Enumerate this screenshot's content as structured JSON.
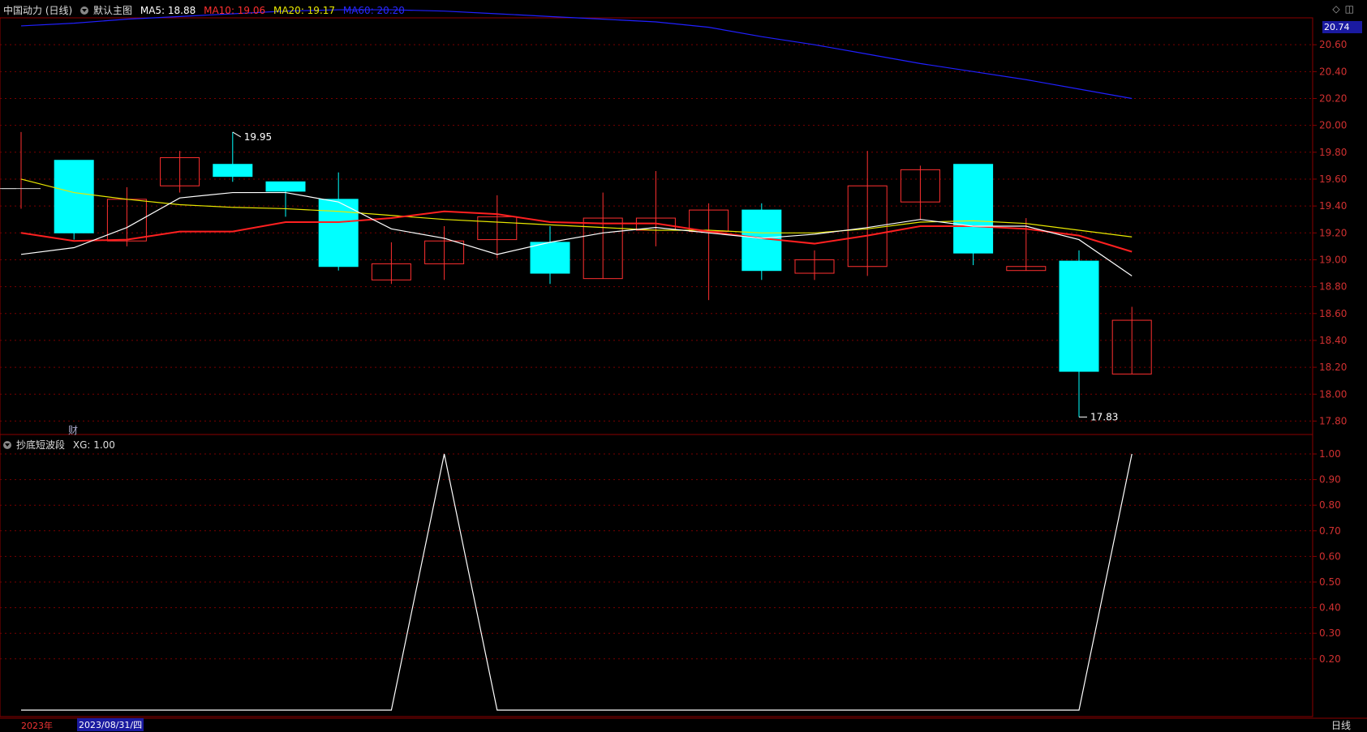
{
  "header": {
    "stock": "中国动力 (日线)",
    "main_chart": "默认主图",
    "ma5": "MA5: 18.88",
    "ma10": "MA10: 19.06",
    "ma20": "MA20: 19.17",
    "ma60": "MA60: 20.20"
  },
  "indicator": {
    "name": "抄底短波段",
    "xg": "XG: 1.00"
  },
  "footer": {
    "year": "2023年",
    "date": "2023/08/31/四",
    "period": "日线"
  },
  "markers": {
    "cai": "财",
    "price_tag": "20.74",
    "high_label": "19.95",
    "low_label": "17.83"
  },
  "colors": {
    "up": "#ff3030",
    "down": "#00ffff",
    "ma5": "#ffffff",
    "ma10": "#ff2020",
    "ma20": "#e8e800",
    "ma60": "#2020ff",
    "grid": "#8b0000"
  },
  "chart_data": [
    {
      "type": "candlestick",
      "y_ticks": [
        "20.60",
        "20.40",
        "20.20",
        "20.00",
        "19.80",
        "19.60",
        "19.40",
        "19.20",
        "19.00",
        "18.80",
        "18.60",
        "18.40",
        "18.20",
        "18.00",
        "17.80"
      ],
      "candles": [
        {
          "open": 19.53,
          "close": 19.53,
          "high": 19.95,
          "low": 19.38
        },
        {
          "open": 19.74,
          "close": 19.2,
          "high": 19.74,
          "low": 19.15
        },
        {
          "open": 19.14,
          "close": 19.45,
          "high": 19.54,
          "low": 19.1
        },
        {
          "open": 19.55,
          "close": 19.76,
          "high": 19.81,
          "low": 19.5
        },
        {
          "open": 19.71,
          "close": 19.62,
          "high": 19.95,
          "low": 19.58
        },
        {
          "open": 19.58,
          "close": 19.51,
          "high": 19.58,
          "low": 19.32
        },
        {
          "open": 19.45,
          "close": 18.95,
          "high": 19.65,
          "low": 18.92
        },
        {
          "open": 18.85,
          "close": 18.97,
          "high": 19.13,
          "low": 18.82
        },
        {
          "open": 18.97,
          "close": 19.14,
          "high": 19.25,
          "low": 18.85
        },
        {
          "open": 19.15,
          "close": 19.32,
          "high": 19.48,
          "low": 19.01
        },
        {
          "open": 19.13,
          "close": 18.9,
          "high": 19.25,
          "low": 18.82
        },
        {
          "open": 18.86,
          "close": 19.31,
          "high": 19.5,
          "low": 18.86
        },
        {
          "open": 19.22,
          "close": 19.31,
          "high": 19.66,
          "low": 19.1
        },
        {
          "open": 19.21,
          "close": 19.37,
          "high": 19.42,
          "low": 18.7
        },
        {
          "open": 19.37,
          "close": 18.92,
          "high": 19.42,
          "low": 18.85
        },
        {
          "open": 18.9,
          "close": 19.0,
          "high": 19.07,
          "low": 18.85
        },
        {
          "open": 18.95,
          "close": 19.55,
          "high": 19.81,
          "low": 18.88
        },
        {
          "open": 19.43,
          "close": 19.67,
          "high": 19.7,
          "low": 19.3
        },
        {
          "open": 19.71,
          "close": 19.05,
          "high": 19.71,
          "low": 18.96
        },
        {
          "open": 18.92,
          "close": 18.95,
          "high": 19.31,
          "low": 18.92
        },
        {
          "open": 18.99,
          "close": 18.17,
          "high": 19.07,
          "low": 17.83
        },
        {
          "open": 18.15,
          "close": 18.55,
          "high": 18.65,
          "low": 18.15
        }
      ],
      "ma5": [
        19.04,
        19.09,
        19.24,
        19.46,
        19.5,
        19.5,
        19.43,
        19.23,
        19.16,
        19.04,
        19.13,
        19.2,
        19.24,
        19.2,
        19.16,
        19.19,
        19.24,
        19.3,
        19.25,
        19.25,
        19.15,
        18.88
      ],
      "ma10": [
        19.2,
        19.14,
        19.15,
        19.21,
        19.21,
        19.28,
        19.28,
        19.31,
        19.36,
        19.34,
        19.28,
        19.27,
        19.27,
        19.21,
        19.16,
        19.12,
        19.18,
        19.25,
        19.25,
        19.23,
        19.18,
        19.06
      ],
      "ma20": [
        19.6,
        19.5,
        19.45,
        19.41,
        19.39,
        19.38,
        19.36,
        19.33,
        19.3,
        19.28,
        19.26,
        19.24,
        19.22,
        19.22,
        19.2,
        19.2,
        19.23,
        19.28,
        19.29,
        19.27,
        19.22,
        19.17
      ],
      "ma60": [
        20.74,
        20.76,
        20.79,
        20.81,
        20.83,
        20.85,
        20.86,
        20.86,
        20.85,
        20.83,
        20.81,
        20.79,
        20.77,
        20.73,
        20.66,
        20.6,
        20.53,
        20.46,
        20.4,
        20.34,
        20.27,
        20.2
      ]
    },
    {
      "type": "line",
      "title": "抄底短波段",
      "y_ticks": [
        "1.00",
        "0.90",
        "0.80",
        "0.70",
        "0.60",
        "0.50",
        "0.40",
        "0.30",
        "0.20"
      ],
      "ylim": [
        0,
        1
      ],
      "series": [
        {
          "name": "XG",
          "values": [
            0,
            0,
            0,
            0,
            0,
            0,
            0,
            0,
            1,
            0,
            0,
            0,
            0,
            0,
            0,
            0,
            0,
            0,
            0,
            0,
            0,
            1
          ]
        }
      ]
    }
  ]
}
